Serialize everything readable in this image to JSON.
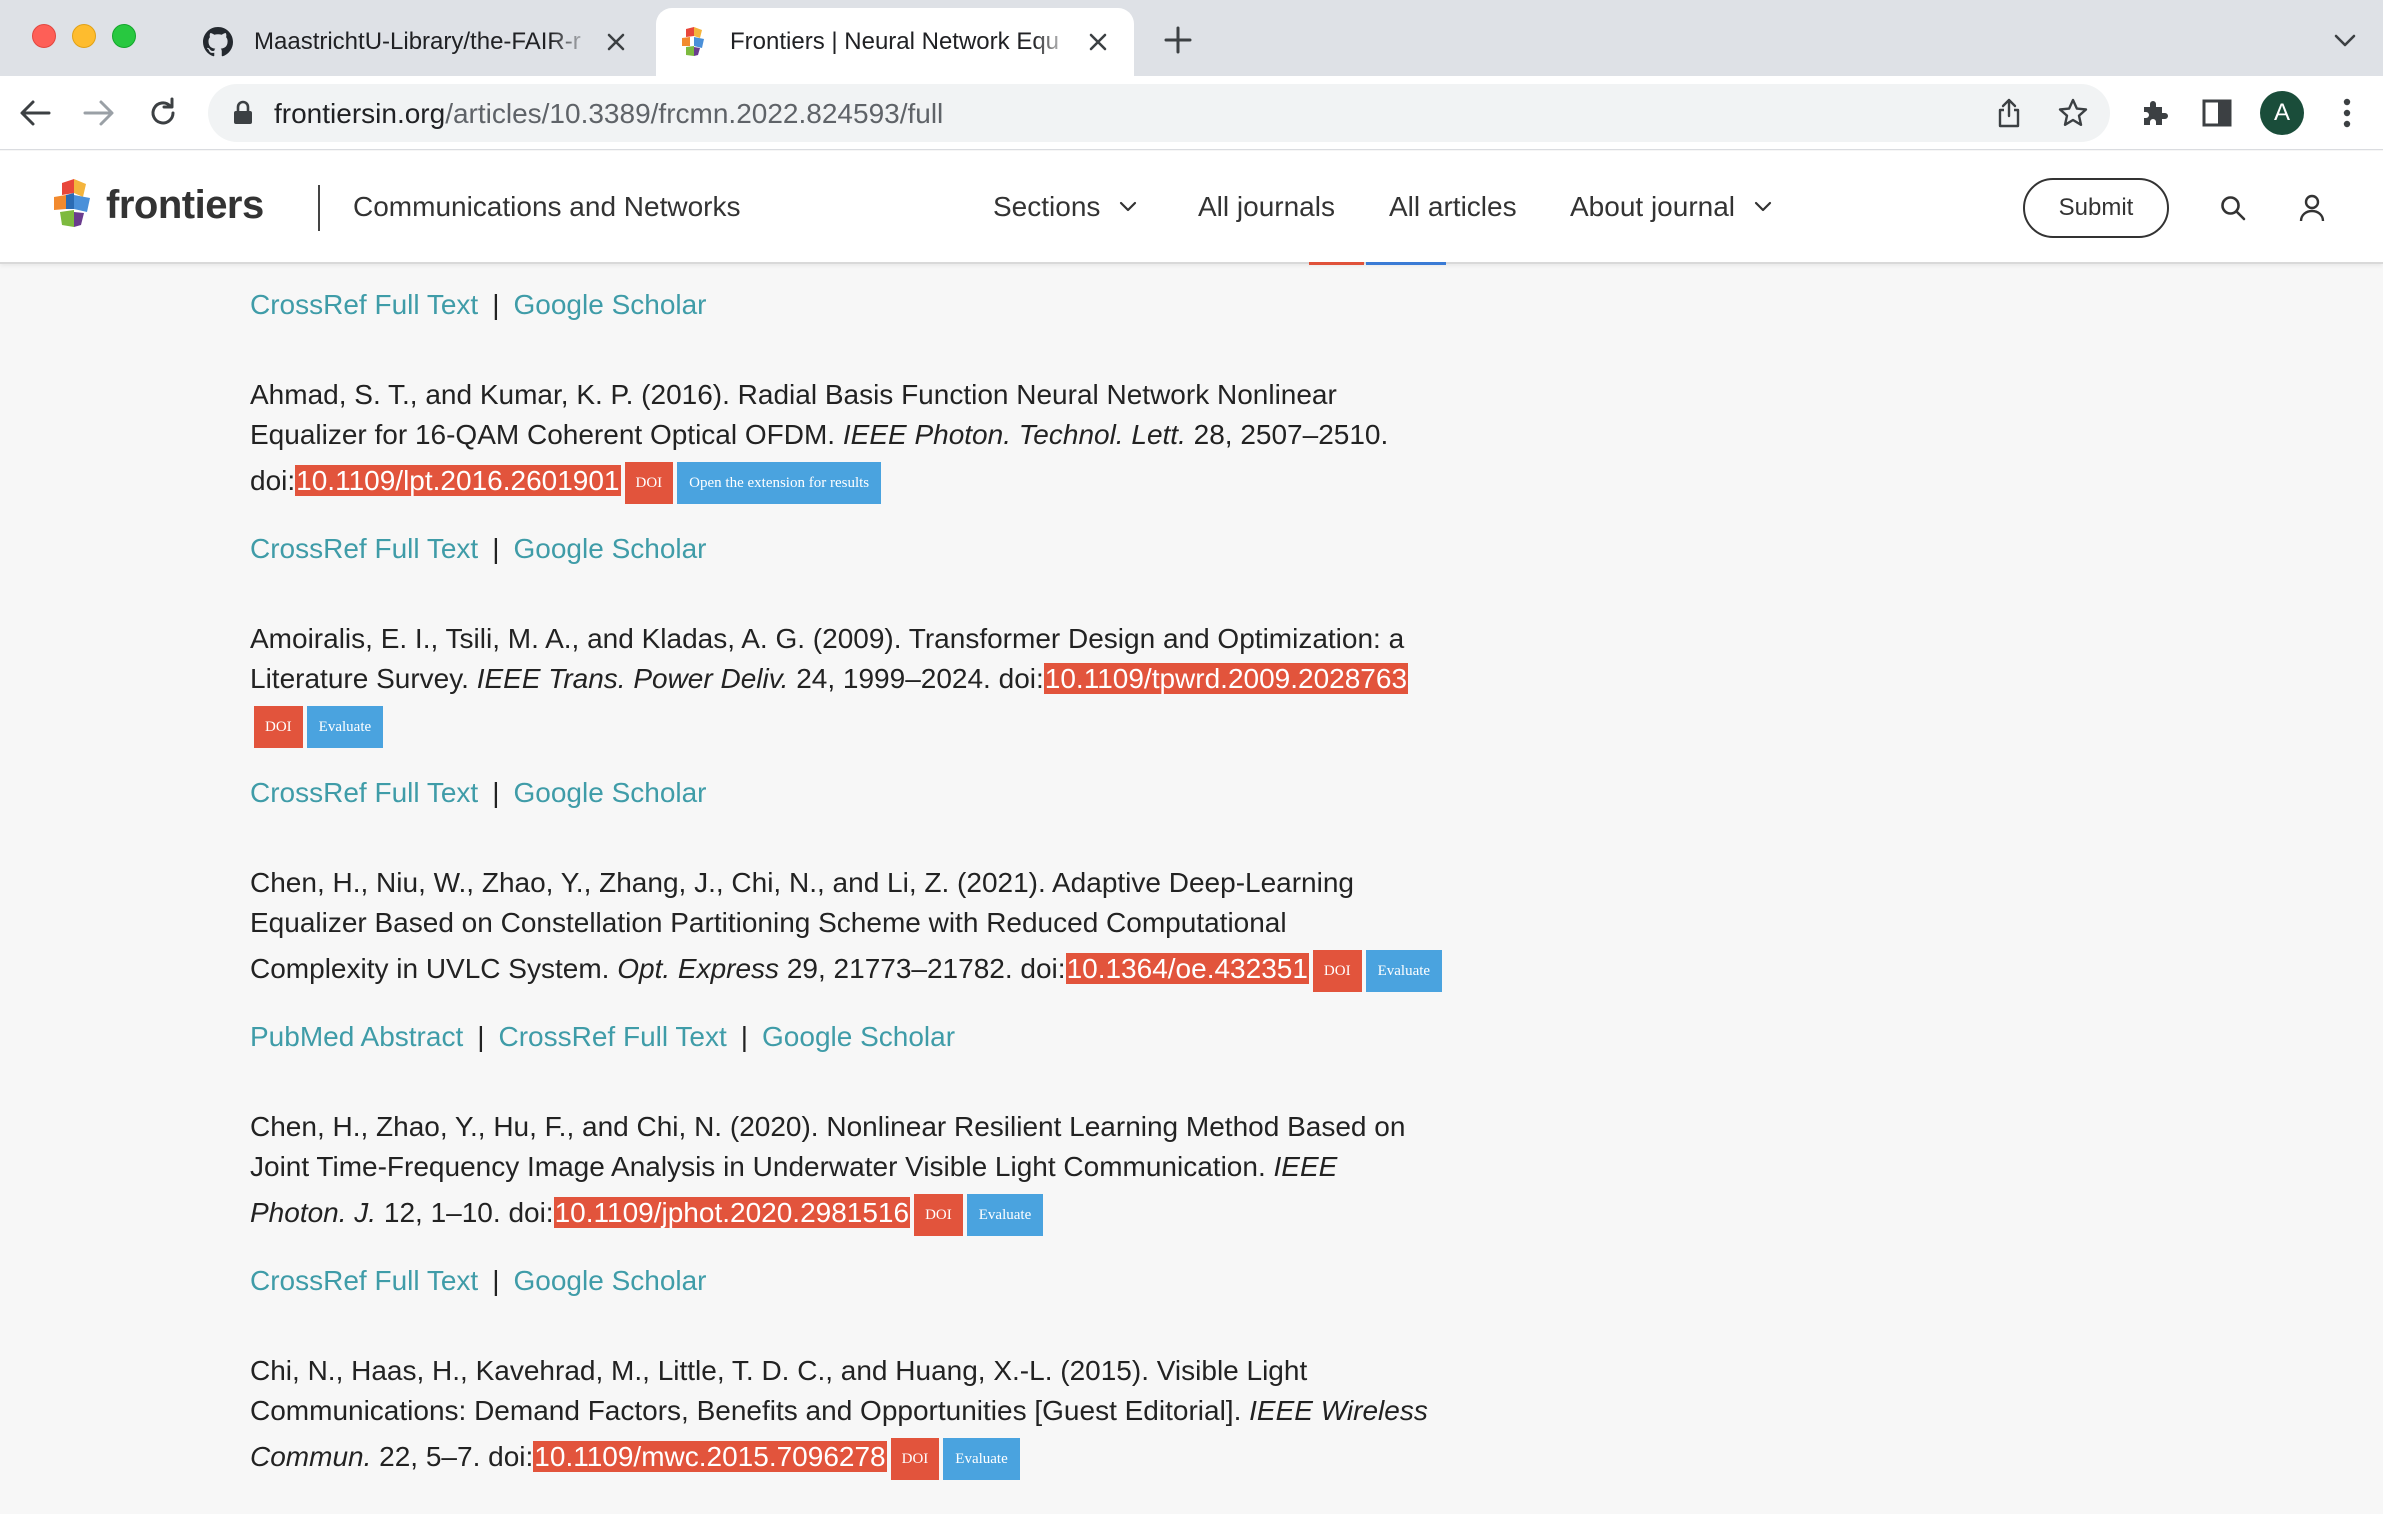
{
  "browser": {
    "tabs": [
      {
        "title": "MaastrichtU-Library/the-FAIR-r",
        "active": false,
        "favicon": "github-icon"
      },
      {
        "title": "Frontiers | Neural Network Equ",
        "active": true,
        "favicon": "frontiers-icon"
      }
    ],
    "url_host": "frontiersin.org",
    "url_path": "/articles/10.3389/frcmn.2022.824593/full",
    "profile_initial": "A"
  },
  "site": {
    "logo_text": "frontiers",
    "journal_name": "Communications and Networks",
    "nav": {
      "sections": "Sections",
      "all_journals": "All journals",
      "all_articles": "All articles",
      "about_journal": "About journal"
    },
    "submit_label": "Submit"
  },
  "references": {
    "top_links": {
      "crossref": "CrossRef Full Text",
      "sep": "|",
      "scholar": "Google Scholar"
    },
    "items": [
      {
        "line1": "Ahmad, S. T., and Kumar, K. P. (2016). Radial Basis Function Neural Network Nonlinear",
        "line2a": "Equalizer for 16-QAM Coherent Optical OFDM. ",
        "line2i": "IEEE Photon. Technol. Lett.",
        "line2b": " 28, 2507–2510.",
        "doi_prefix": "doi:",
        "doi": "10.1109/lpt.2016.2601901",
        "badge_doi": "DOI",
        "badge_action": "Open the extension for results",
        "crossref": "CrossRef Full Text",
        "sep": "|",
        "scholar": "Google Scholar"
      },
      {
        "line1": "Amoiralis, E. I., Tsili, M. A., and Kladas, A. G. (2009). Transformer Design and Optimization: a",
        "line2a": "Literature Survey. ",
        "line2i": "IEEE Trans. Power Deliv.",
        "line2b": " 24, 1999–2024. ",
        "doi_prefix": "doi:",
        "doi": "10.1109/tpwrd.2009.2028763",
        "badge_doi": "DOI",
        "badge_action": "Evaluate",
        "crossref": "CrossRef Full Text",
        "sep": "|",
        "scholar": "Google Scholar"
      },
      {
        "line1": "Chen, H., Niu, W., Zhao, Y., Zhang, J., Chi, N., and Li, Z. (2021). Adaptive Deep-Learning",
        "line2": "Equalizer Based on Constellation Partitioning Scheme with Reduced Computational",
        "line3a": "Complexity in UVLC System. ",
        "line3i": "Opt. Express",
        "line3b": " 29, 21773–21782. ",
        "doi_prefix": "doi:",
        "doi": "10.1364/oe.432351",
        "badge_doi": "DOI",
        "badge_action": "Evaluate",
        "pubmed": "PubMed Abstract",
        "crossref": "CrossRef Full Text",
        "sep": "|",
        "scholar": "Google Scholar"
      },
      {
        "line1": "Chen, H., Zhao, Y., Hu, F., and Chi, N. (2020). Nonlinear Resilient Learning Method Based on",
        "line2a": "Joint Time-Frequency Image Analysis in Underwater Visible Light Communication. ",
        "line2i": "IEEE",
        "line3i": "Photon. J.",
        "line3b": " 12, 1–10. ",
        "doi_prefix": "doi:",
        "doi": "10.1109/jphot.2020.2981516",
        "badge_doi": "DOI",
        "badge_action": "Evaluate",
        "crossref": "CrossRef Full Text",
        "sep": "|",
        "scholar": "Google Scholar"
      },
      {
        "line1": "Chi, N., Haas, H., Kavehrad, M., Little, T. D. C., and Huang, X.-L. (2015). Visible Light",
        "line2a": "Communications: Demand Factors, Benefits and Opportunities [Guest Editorial]. ",
        "line2i": "IEEE Wireless",
        "line3i": "Commun.",
        "line3b": " 22, 5–7. ",
        "doi_prefix": "doi:",
        "doi": "10.1109/mwc.2015.7096278",
        "badge_doi": "DOI",
        "badge_action": "Evaluate"
      }
    ]
  }
}
